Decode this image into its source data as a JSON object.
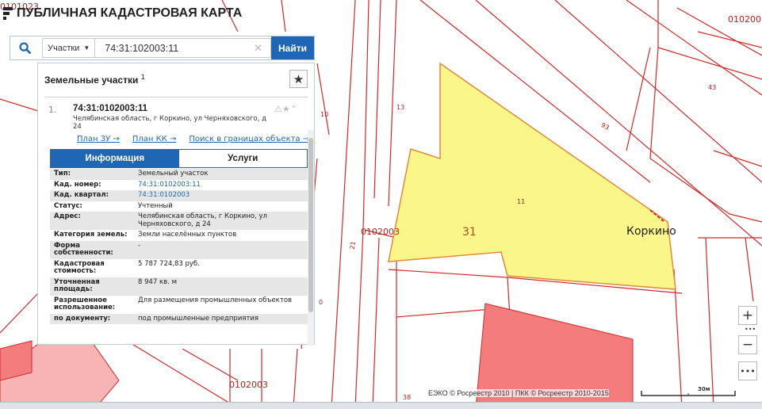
{
  "app": {
    "title": "ПУБЛИЧНАЯ КАДАСТРОВАЯ КАРТА"
  },
  "search": {
    "layer": "Участки",
    "query": "74:31:102003:11",
    "find_label": "Найти"
  },
  "panel": {
    "title": "Земельные участки",
    "count": "1",
    "item": {
      "index": "1.",
      "cad_number": "74:31:0102003:11",
      "address": "Челябинская область, г Коркино, ул Черняховского, д 24",
      "links": [
        "План ЗУ →",
        "План КК →",
        "Поиск в границах объекта →"
      ]
    },
    "tabs": [
      "Информация",
      "Услуги"
    ],
    "rows": [
      {
        "key": "Тип:",
        "value": "Земельный участок"
      },
      {
        "key": "Кад. номер:",
        "value": "74:31:0102003:11"
      },
      {
        "key": "Кад. квартал:",
        "value": "74:31:0102003"
      },
      {
        "key": "Статус:",
        "value": "Учтенный"
      },
      {
        "key": "Адрес:",
        "value": "Челябинская область, г Коркино, ул Черняховского, д 24"
      },
      {
        "key": "Категория земель:",
        "value": "Земли населённых пунктов"
      },
      {
        "key": "Форма собственности:",
        "value": "-"
      },
      {
        "key": "Кадастровая стоимость:",
        "value": "5 787 724,83 руб."
      },
      {
        "key": "Уточненная площадь:",
        "value": "8 947 кв. м"
      },
      {
        "key": "Разрешенное использование:",
        "value": "Для размещения промышленных объектов"
      },
      {
        "key": "по документу:",
        "value": "под промышленные предприятия"
      }
    ]
  },
  "map": {
    "labels": {
      "quarter_top_left": "0101023",
      "quarter_top_right": "010200",
      "quarter_mid": "0102003",
      "quarter_bottom": "0102003",
      "town": "Коркино",
      "parcel_31": "31",
      "parcel_11": "11",
      "parcel_13": "13",
      "parcel_10": "10",
      "parcel_43": "43",
      "parcel_93": "93",
      "parcel_21": "21",
      "parcel_0": "0",
      "parcel_38": "38"
    },
    "colors": {
      "selected_parcel": "#fbf68a",
      "building": "#f47c7c",
      "boundary": "#cf2a2a",
      "accent": "#1f66b4"
    }
  },
  "controls": {
    "zoom_in": "+",
    "zoom_out": "−",
    "dots": "•••",
    "more": "•••"
  },
  "attribution": "ЕЭКО © Росреестр 2010 | ПКК © Росреестр 2010-2015",
  "scale": {
    "label": "30м"
  }
}
